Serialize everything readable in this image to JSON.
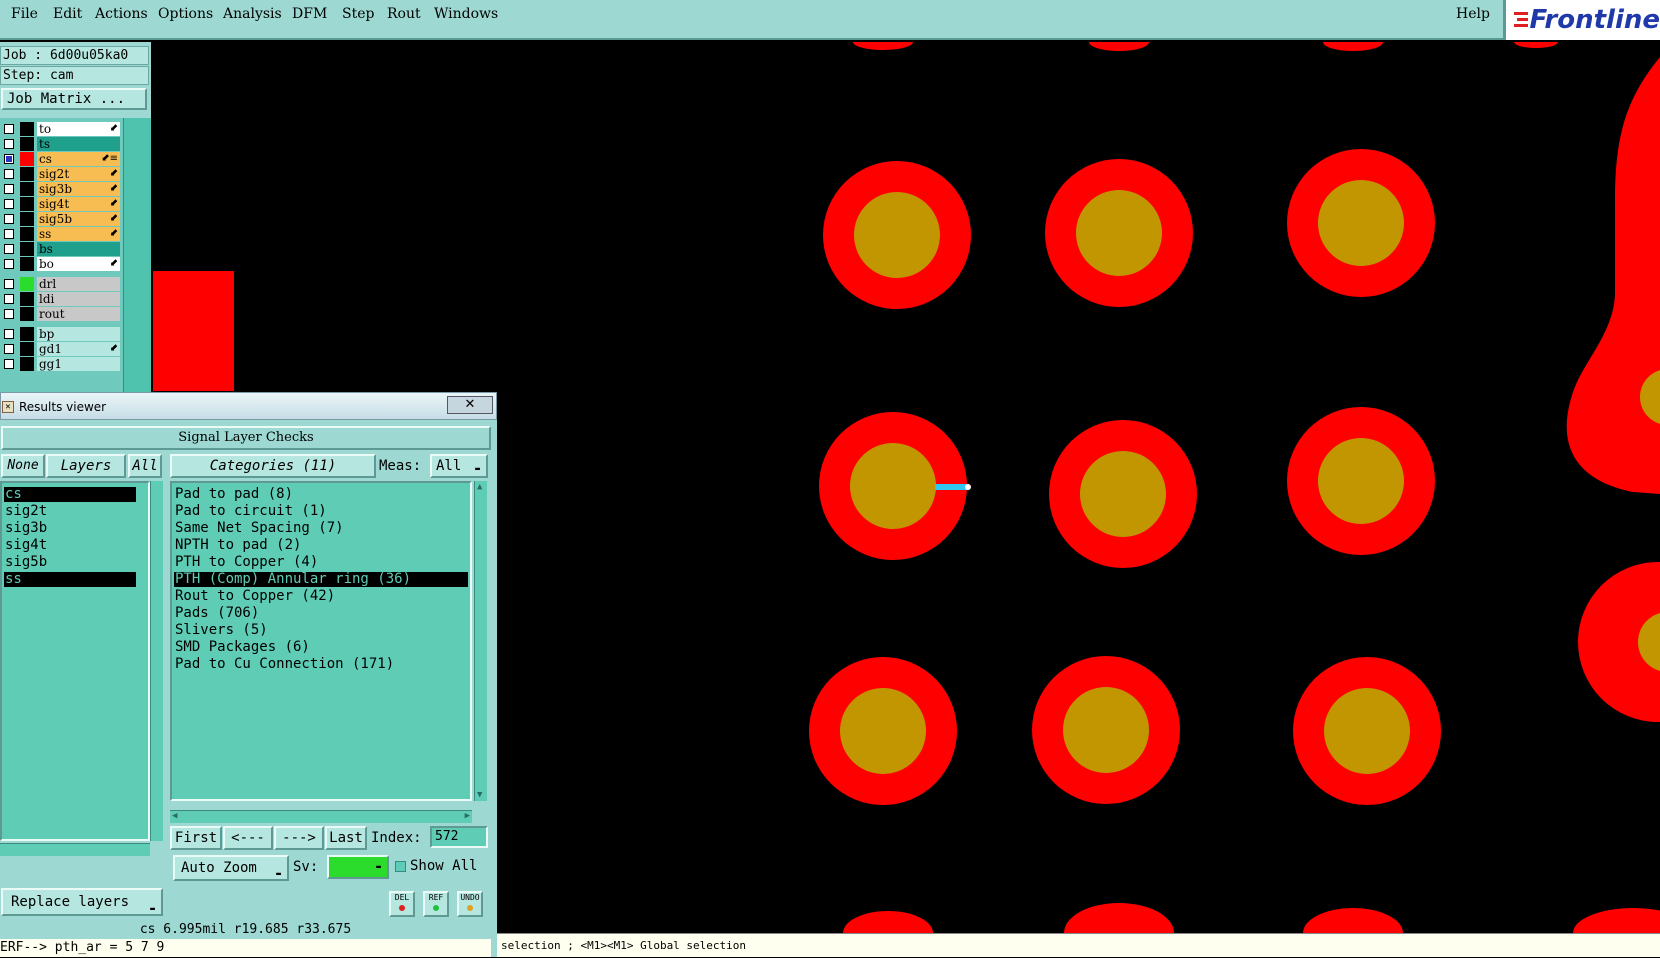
{
  "menu": {
    "items": [
      "File",
      "Edit",
      "Actions",
      "Options",
      "Analysis",
      "DFM",
      "Step",
      "Rout",
      "Windows"
    ],
    "help": "Help",
    "logo": "Frontline"
  },
  "job": {
    "job_label": "Job : 6d00u05ka0",
    "step_label": "Step: cam",
    "matrix_button": "Job Matrix ..."
  },
  "layers": [
    {
      "name": "to",
      "color": "#ffffff",
      "swatch": "#000000",
      "sel": false,
      "mark": "⬋"
    },
    {
      "name": "ts",
      "color": "#1fa08c",
      "swatch": "#000000",
      "sel": false,
      "mark": ""
    },
    {
      "name": "cs",
      "color": "#f8bd52",
      "swatch": "#ff0000",
      "sel": true,
      "mark": "⬋≡"
    },
    {
      "name": "sig2t",
      "color": "#f8bd52",
      "swatch": "#000000",
      "sel": false,
      "mark": "⬋"
    },
    {
      "name": "sig3b",
      "color": "#f8bd52",
      "swatch": "#000000",
      "sel": false,
      "mark": "⬋"
    },
    {
      "name": "sig4t",
      "color": "#f8bd52",
      "swatch": "#000000",
      "sel": false,
      "mark": "⬋"
    },
    {
      "name": "sig5b",
      "color": "#f8bd52",
      "swatch": "#000000",
      "sel": false,
      "mark": "⬋"
    },
    {
      "name": "ss",
      "color": "#f8bd52",
      "swatch": "#000000",
      "sel": false,
      "mark": "⬋"
    },
    {
      "name": "bs",
      "color": "#1fa08c",
      "swatch": "#000000",
      "sel": false,
      "mark": ""
    },
    {
      "name": "bo",
      "color": "#ffffff",
      "swatch": "#000000",
      "sel": false,
      "mark": "⬋"
    },
    {
      "name": "drl",
      "color": "#c8c8c8",
      "swatch": "#2cdc2c",
      "sel": false,
      "mark": ""
    },
    {
      "name": "ldi",
      "color": "#c8c8c8",
      "swatch": "#000000",
      "sel": false,
      "mark": ""
    },
    {
      "name": "rout",
      "color": "#c8c8c8",
      "swatch": "#000000",
      "sel": false,
      "mark": ""
    },
    {
      "name": "bp",
      "color": "#b6e6e0",
      "swatch": "#000000",
      "sel": false,
      "mark": ""
    },
    {
      "name": "gd1",
      "color": "#b6e6e0",
      "swatch": "#000000",
      "sel": false,
      "mark": "⬋"
    },
    {
      "name": "gg1",
      "color": "#b6e6e0",
      "swatch": "#000000",
      "sel": false,
      "mark": ""
    }
  ],
  "results_viewer": {
    "title": "Results viewer",
    "close": "✕",
    "heading": "Signal Layer Checks",
    "none_btn": "None",
    "layers_btn": "Layers",
    "all_btn": "All",
    "categories_btn": "Categories (11)",
    "meas_label": "Meas:",
    "meas_value": "All",
    "layer_items": [
      {
        "name": "cs",
        "sel": true
      },
      {
        "name": "sig2t",
        "sel": false
      },
      {
        "name": "sig3b",
        "sel": false
      },
      {
        "name": "sig4t",
        "sel": false
      },
      {
        "name": "sig5b",
        "sel": false
      },
      {
        "name": "ss",
        "sel": true
      }
    ],
    "categories": [
      {
        "name": "Pad to pad (8)",
        "sel": false
      },
      {
        "name": "Pad to circuit (1)",
        "sel": false
      },
      {
        "name": "Same Net Spacing (7)",
        "sel": false
      },
      {
        "name": "NPTH to pad (2)",
        "sel": false
      },
      {
        "name": "PTH to Copper (4)",
        "sel": false
      },
      {
        "name": "PTH (Comp) Annular ring (36)",
        "sel": true
      },
      {
        "name": "Rout to Copper (42)",
        "sel": false
      },
      {
        "name": "Pads (706)",
        "sel": false
      },
      {
        "name": "Slivers (5)",
        "sel": false
      },
      {
        "name": "SMD Packages (6)",
        "sel": false
      },
      {
        "name": "Pad to Cu Connection (171)",
        "sel": false
      }
    ],
    "first_btn": "First",
    "prev_btn": "<---",
    "next_btn": "--->",
    "last_btn": "Last",
    "index_label": "Index:",
    "index_value": "572",
    "zoom_btn": "Auto Zoom",
    "sv_label": "Sv:",
    "show_all": "Show All",
    "replace_btn": "Replace layers",
    "del_btn": "DEL",
    "ref_btn": "REF",
    "undo_btn": "UNDO",
    "status": "cs 6.995mil  r19.685  r33.675",
    "cmdline": "ERF--> pth_ar = 5 7 9"
  },
  "bottom_status": "selection ; <M1><M1> Global selection",
  "colors": {
    "pad_ring": "#ff0000",
    "pad_hole": "#c29600",
    "marker": "#30c8f0",
    "panel": "#9dd9d2",
    "list_bg": "#5fcdb5"
  }
}
